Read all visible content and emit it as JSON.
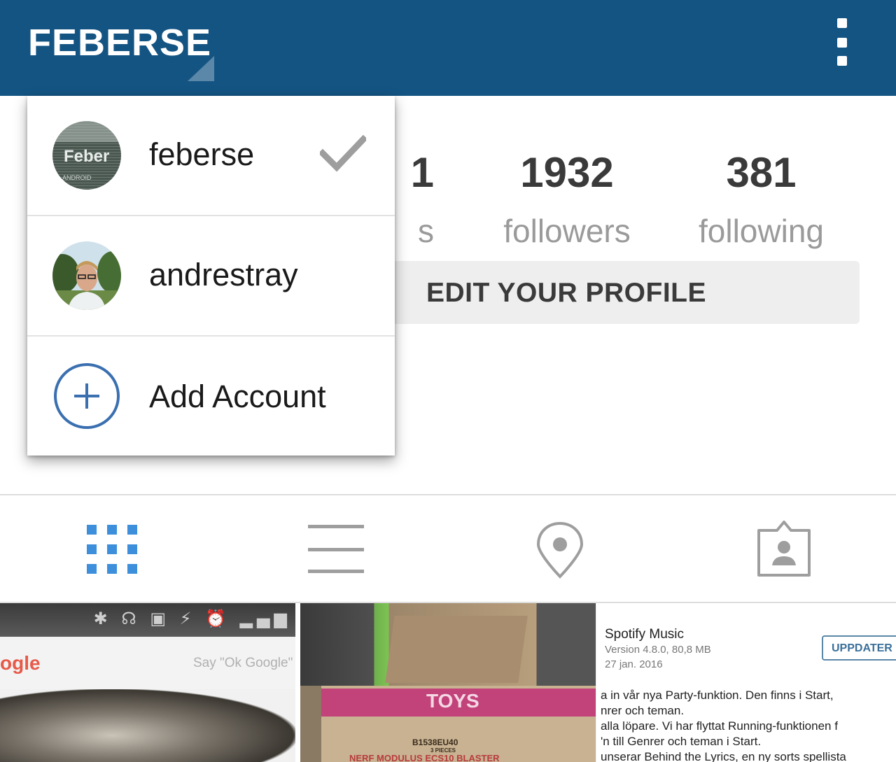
{
  "header": {
    "title": "FEBERSE",
    "menu_icon": "overflow-menu-icon",
    "bg_color": "#145483"
  },
  "profile": {
    "posts_partial_num": "1",
    "posts_partial_label": "s",
    "followers_count": "1932",
    "followers_label": "followers",
    "following_count": "381",
    "following_label": "following",
    "edit_button": "EDIT YOUR PROFILE"
  },
  "account_switcher": {
    "items": [
      {
        "username": "feberse",
        "selected": true,
        "avatar_icon": "feber-logo-avatar",
        "avatar_text": "Feber",
        "avatar_subtext": "ANDROID"
      },
      {
        "username": "andrestray",
        "selected": false,
        "avatar_icon": "user-photo-avatar"
      },
      {
        "username": "Add Account",
        "icon": "plus-circle-icon"
      }
    ]
  },
  "tabs": [
    {
      "name": "grid",
      "icon": "grid-icon",
      "active": true
    },
    {
      "name": "list",
      "icon": "list-icon",
      "active": false
    },
    {
      "name": "location",
      "icon": "location-pin-icon",
      "active": false
    },
    {
      "name": "tagged",
      "icon": "tagged-person-icon",
      "active": false
    }
  ],
  "posts": {
    "thumb1": {
      "logo_tail": "ogle",
      "say_text": "Say \"Ok Google\""
    },
    "thumb2": {
      "box_label": "TOYS",
      "code": "B1538EU40",
      "pieces": "3 PIECES",
      "product": "NERF MODULUS ECS10 BLASTER"
    },
    "thumb3": {
      "app_name": "Spotify Music",
      "version": "Version 4.8.0, 80,8 MB",
      "date": "27 jan. 2016",
      "update_button": "UPPDATER",
      "lines": [
        "a in vår nya Party-funktion. Den finns i Start,",
        "nrer och teman.",
        "alla löpare. Vi har flyttat Running-funktionen f",
        "'n till Genrer och teman i Start.",
        "unserar Behind the Lyrics, en ny sorts spellista"
      ]
    }
  },
  "colors": {
    "accent_blue": "#3d8fdc",
    "gray_icon": "#9e9e9e"
  }
}
